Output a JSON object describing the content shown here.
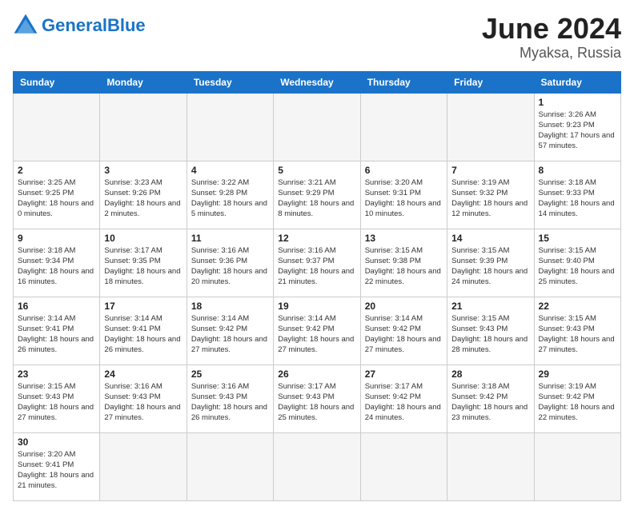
{
  "header": {
    "logo_general": "General",
    "logo_blue": "Blue",
    "title": "June 2024",
    "location": "Myaksa, Russia"
  },
  "weekdays": [
    "Sunday",
    "Monday",
    "Tuesday",
    "Wednesday",
    "Thursday",
    "Friday",
    "Saturday"
  ],
  "days": {
    "1": {
      "sunrise": "3:26 AM",
      "sunset": "9:23 PM",
      "daylight": "17 hours and 57 minutes."
    },
    "2": {
      "sunrise": "3:25 AM",
      "sunset": "9:25 PM",
      "daylight": "18 hours and 0 minutes."
    },
    "3": {
      "sunrise": "3:23 AM",
      "sunset": "9:26 PM",
      "daylight": "18 hours and 2 minutes."
    },
    "4": {
      "sunrise": "3:22 AM",
      "sunset": "9:28 PM",
      "daylight": "18 hours and 5 minutes."
    },
    "5": {
      "sunrise": "3:21 AM",
      "sunset": "9:29 PM",
      "daylight": "18 hours and 8 minutes."
    },
    "6": {
      "sunrise": "3:20 AM",
      "sunset": "9:31 PM",
      "daylight": "18 hours and 10 minutes."
    },
    "7": {
      "sunrise": "3:19 AM",
      "sunset": "9:32 PM",
      "daylight": "18 hours and 12 minutes."
    },
    "8": {
      "sunrise": "3:18 AM",
      "sunset": "9:33 PM",
      "daylight": "18 hours and 14 minutes."
    },
    "9": {
      "sunrise": "3:18 AM",
      "sunset": "9:34 PM",
      "daylight": "18 hours and 16 minutes."
    },
    "10": {
      "sunrise": "3:17 AM",
      "sunset": "9:35 PM",
      "daylight": "18 hours and 18 minutes."
    },
    "11": {
      "sunrise": "3:16 AM",
      "sunset": "9:36 PM",
      "daylight": "18 hours and 20 minutes."
    },
    "12": {
      "sunrise": "3:16 AM",
      "sunset": "9:37 PM",
      "daylight": "18 hours and 21 minutes."
    },
    "13": {
      "sunrise": "3:15 AM",
      "sunset": "9:38 PM",
      "daylight": "18 hours and 22 minutes."
    },
    "14": {
      "sunrise": "3:15 AM",
      "sunset": "9:39 PM",
      "daylight": "18 hours and 24 minutes."
    },
    "15": {
      "sunrise": "3:15 AM",
      "sunset": "9:40 PM",
      "daylight": "18 hours and 25 minutes."
    },
    "16": {
      "sunrise": "3:14 AM",
      "sunset": "9:41 PM",
      "daylight": "18 hours and 26 minutes."
    },
    "17": {
      "sunrise": "3:14 AM",
      "sunset": "9:41 PM",
      "daylight": "18 hours and 26 minutes."
    },
    "18": {
      "sunrise": "3:14 AM",
      "sunset": "9:42 PM",
      "daylight": "18 hours and 27 minutes."
    },
    "19": {
      "sunrise": "3:14 AM",
      "sunset": "9:42 PM",
      "daylight": "18 hours and 27 minutes."
    },
    "20": {
      "sunrise": "3:14 AM",
      "sunset": "9:42 PM",
      "daylight": "18 hours and 27 minutes."
    },
    "21": {
      "sunrise": "3:15 AM",
      "sunset": "9:43 PM",
      "daylight": "18 hours and 28 minutes."
    },
    "22": {
      "sunrise": "3:15 AM",
      "sunset": "9:43 PM",
      "daylight": "18 hours and 27 minutes."
    },
    "23": {
      "sunrise": "3:15 AM",
      "sunset": "9:43 PM",
      "daylight": "18 hours and 27 minutes."
    },
    "24": {
      "sunrise": "3:16 AM",
      "sunset": "9:43 PM",
      "daylight": "18 hours and 27 minutes."
    },
    "25": {
      "sunrise": "3:16 AM",
      "sunset": "9:43 PM",
      "daylight": "18 hours and 26 minutes."
    },
    "26": {
      "sunrise": "3:17 AM",
      "sunset": "9:43 PM",
      "daylight": "18 hours and 25 minutes."
    },
    "27": {
      "sunrise": "3:17 AM",
      "sunset": "9:42 PM",
      "daylight": "18 hours and 24 minutes."
    },
    "28": {
      "sunrise": "3:18 AM",
      "sunset": "9:42 PM",
      "daylight": "18 hours and 23 minutes."
    },
    "29": {
      "sunrise": "3:19 AM",
      "sunset": "9:42 PM",
      "daylight": "18 hours and 22 minutes."
    },
    "30": {
      "sunrise": "3:20 AM",
      "sunset": "9:41 PM",
      "daylight": "18 hours and 21 minutes."
    }
  }
}
